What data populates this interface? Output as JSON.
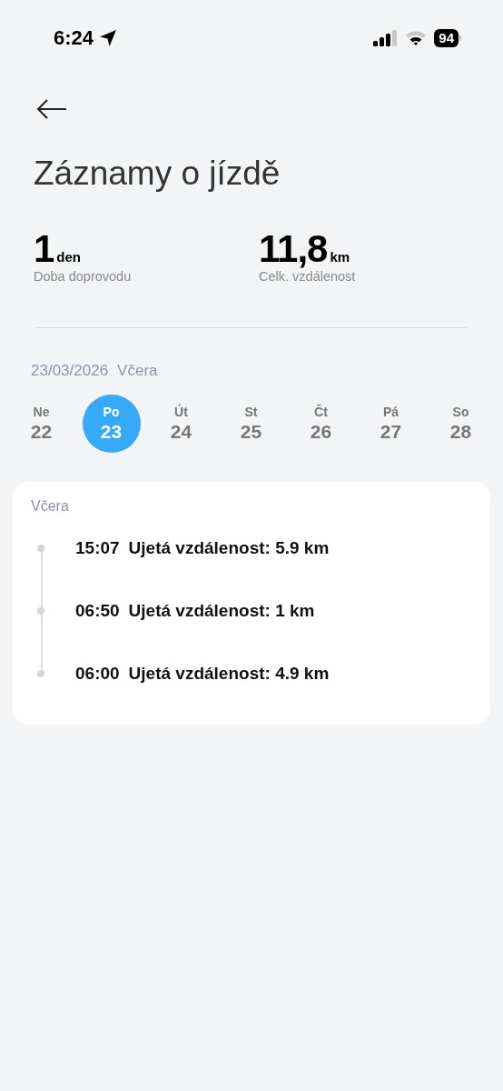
{
  "status_bar": {
    "time": "6:24",
    "battery": "94"
  },
  "title": "Záznamy o jízdě",
  "stats": [
    {
      "value": "1",
      "unit": "den",
      "label": "Doba doprovodu"
    },
    {
      "value": "11,8",
      "unit": "km",
      "label": "Celk. vzdálenost"
    }
  ],
  "date": {
    "date": "23/03/2026",
    "relative": "Včera"
  },
  "days": [
    {
      "name": "Ne",
      "number": "22",
      "selected": false
    },
    {
      "name": "Po",
      "number": "23",
      "selected": true
    },
    {
      "name": "Út",
      "number": "24",
      "selected": false
    },
    {
      "name": "St",
      "number": "25",
      "selected": false
    },
    {
      "name": "Čt",
      "number": "26",
      "selected": false
    },
    {
      "name": "Pá",
      "number": "27",
      "selected": false
    },
    {
      "name": "So",
      "number": "28",
      "selected": false
    }
  ],
  "trips_card": {
    "heading": "Včera",
    "trips": [
      {
        "time": "15:07",
        "text": "Ujetá vzdálenost: 5.9 km"
      },
      {
        "time": "06:50",
        "text": "Ujetá vzdálenost: 1 km"
      },
      {
        "time": "06:00",
        "text": "Ujetá vzdálenost: 4.9 km"
      }
    ]
  }
}
